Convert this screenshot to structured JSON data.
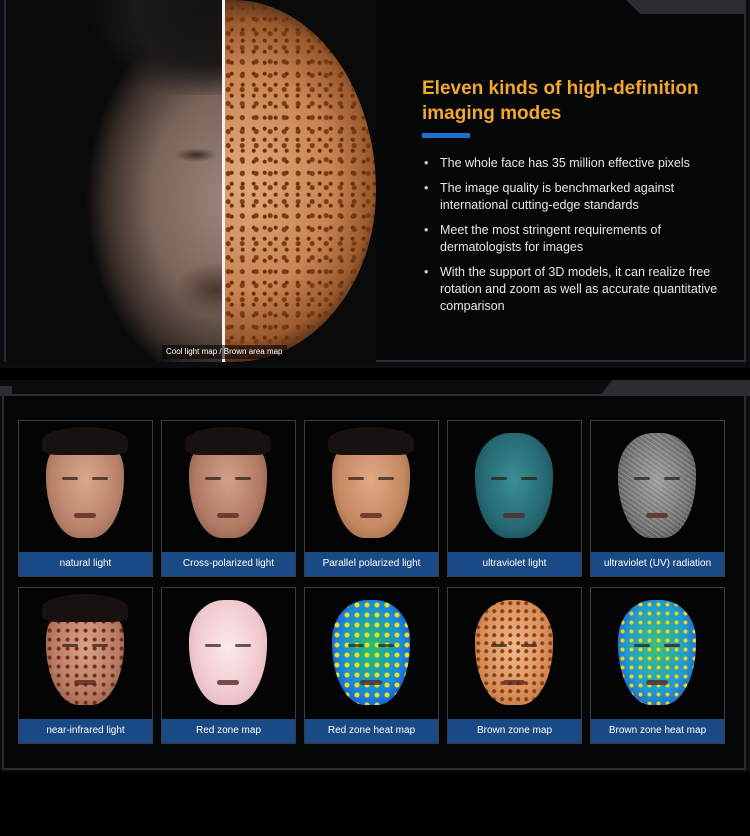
{
  "hero": {
    "image_caption": "Cool light map / Brown area map",
    "headline": "Eleven kinds of high-definition imaging modes",
    "bullets": [
      "The whole face has 35 million effective pixels",
      "The image quality is benchmarked against international cutting-edge standards",
      "Meet the most stringent requirements of dermatologists for images",
      "With the support of 3D models, it can realize free rotation and zoom as well as accurate quantitative comparison"
    ],
    "bullet_glyph": "•"
  },
  "modes": [
    {
      "label": "natural light",
      "style": "skin"
    },
    {
      "label": "Cross-polarized light",
      "style": "cross"
    },
    {
      "label": "Parallel polarized light",
      "style": "parallel"
    },
    {
      "label": "ultraviolet light",
      "style": "uv"
    },
    {
      "label": "ultraviolet (UV) radiation",
      "style": "uvr"
    },
    {
      "label": "near-infrared light",
      "style": "nir"
    },
    {
      "label": "Red zone map",
      "style": "redzone"
    },
    {
      "label": "Red zone heat map",
      "style": "heat"
    },
    {
      "label": "Brown zone map",
      "style": "brown"
    },
    {
      "label": "Brown zone heat map",
      "style": "bheat"
    }
  ],
  "colors": {
    "headline": "#f3a72c",
    "accent_bar": "#1e6fd0",
    "label_bg": "#1a4a86",
    "frame": "#2a2d33"
  }
}
